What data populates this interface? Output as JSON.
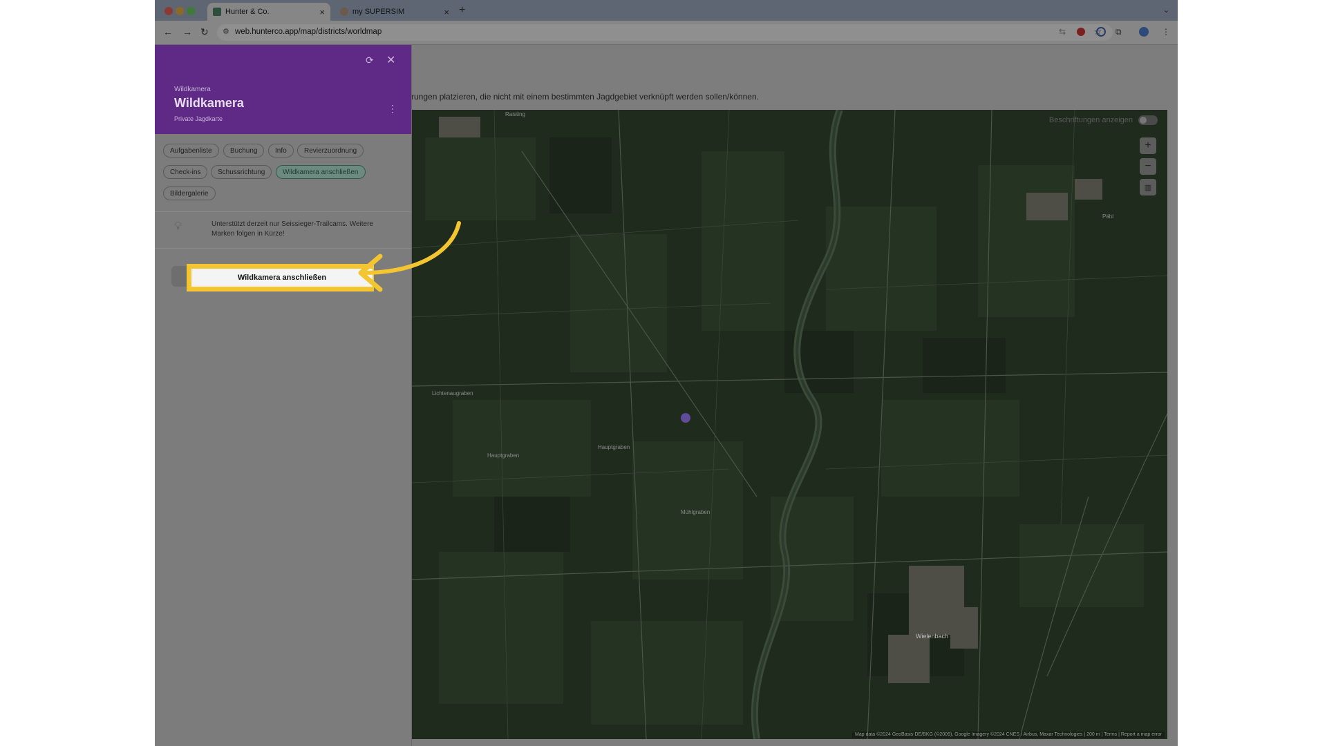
{
  "browser": {
    "tabs": [
      {
        "label": "Hunter & Co.",
        "close": "×"
      },
      {
        "label": "my SUPERSIM",
        "close": "×"
      }
    ],
    "new_tab": "+",
    "tab_menu": "⌄",
    "url": "web.hunterco.app/map/districts/worldmap"
  },
  "page": {
    "intro_text": "rungen platzieren, die nicht mit einem bestimmten Jagdgebiet verknüpft werden sollen/können."
  },
  "sidebar": {
    "overline": "Wildkamera",
    "title": "Wildkamera",
    "subtitle": "Private Jagdkarte",
    "chips": [
      {
        "label": "Aufgabenliste"
      },
      {
        "label": "Buchung"
      },
      {
        "label": "Info"
      },
      {
        "label": "Revierzuordnung"
      },
      {
        "label": "Check-ins"
      },
      {
        "label": "Schussrichtung"
      },
      {
        "label": "Wildkamera anschließen"
      },
      {
        "label": "Bildergalerie"
      }
    ],
    "selected_chip": "Wildkamera anschließen",
    "hint": "Unterstützt derzeit nur Seissieger-Trailcams. Weitere Marken folgen in Kürze!",
    "connect_button": "Wildkamera anschließen"
  },
  "map": {
    "labels_toggle": "Beschriftungen anzeigen",
    "zoom_in": "+",
    "zoom_out": "−",
    "place_labels": [
      "Raisting",
      "Wielenbach",
      "Pähl",
      "Hauptgraben",
      "Hauptgraben",
      "Mühlgraben",
      "Lichtenaugraben"
    ],
    "attribution": "Map data ©2024 GeoBasis-DE/BKG (©2009), Google Imagery ©2024 CNES / Airbus, Maxar Technologies | 200 m | Terms | Report a map error"
  },
  "colors": {
    "header_purple": "#5f2a85",
    "highlight_yellow": "#f2c531"
  }
}
